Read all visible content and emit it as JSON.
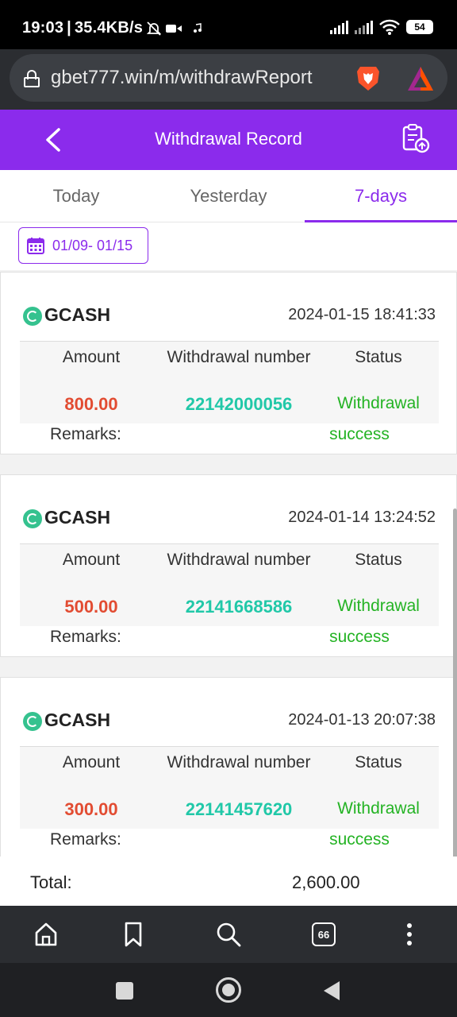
{
  "status_bar": {
    "time": "19:03",
    "network_speed": "35.4KB/s",
    "battery": "54",
    "icons": [
      "bell-off-icon",
      "video-icon",
      "music-note-icon",
      "signal-icon",
      "wifi-icon",
      "battery-icon"
    ]
  },
  "browser": {
    "url": "gbet777.win/m/withdrawReport",
    "icons": [
      "lock-icon",
      "brave-lion-icon",
      "brave-rewards-icon"
    ],
    "bottom_nav": [
      "home-icon",
      "bookmark-icon",
      "search-icon",
      "tabs-icon",
      "more-icon"
    ],
    "tab_count": "66"
  },
  "header": {
    "title": "Withdrawal Record",
    "color": "#8b2bec"
  },
  "tabs": [
    {
      "label": "Today",
      "active": false
    },
    {
      "label": "Yesterday",
      "active": false
    },
    {
      "label": "7-days",
      "active": true
    }
  ],
  "date_filter": "01/09- 01/15",
  "columns": {
    "amount": "Amount",
    "withdrawal_number": "Withdrawal number",
    "status": "Status",
    "remarks": "Remarks:"
  },
  "records": [
    {
      "method": "GCASH",
      "time": "2024-01-15 18:41:33",
      "amount": "800.00",
      "withdrawal_number": "22142000056",
      "status_line1": "Withdrawal",
      "status_line2": "success"
    },
    {
      "method": "GCASH",
      "time": "2024-01-14 13:24:52",
      "amount": "500.00",
      "withdrawal_number": "22141668586",
      "status_line1": "Withdrawal",
      "status_line2": "success"
    },
    {
      "method": "GCASH",
      "time": "2024-01-13 20:07:38",
      "amount": "300.00",
      "withdrawal_number": "22141457620",
      "status_line1": "Withdrawal",
      "status_line2": "success"
    }
  ],
  "total": {
    "label": "Total:",
    "value": "2,600.00"
  },
  "colors": {
    "amount": "#e24c32",
    "withdrawal_number": "#21c8a8",
    "status": "#24b324"
  }
}
